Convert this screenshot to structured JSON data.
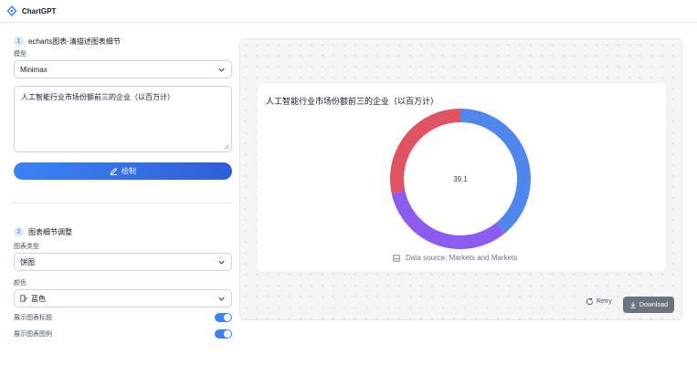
{
  "app": {
    "title": "ChartGPT",
    "logo_icon": "chartgpt-logo-icon"
  },
  "step1": {
    "number": "1",
    "title": "echarts图表-清描述图表细节"
  },
  "model": {
    "label": "模型",
    "value": "Minimax"
  },
  "prompt": {
    "value": "人工智能行业市场份额前三的企业（以百万计）"
  },
  "draw_button": {
    "label": "绘制",
    "icon": "edit-icon"
  },
  "step2": {
    "number": "2",
    "title": "图表细节调整"
  },
  "chart_type": {
    "label": "图表类型",
    "value": "饼图"
  },
  "color": {
    "label": "颜色",
    "value": "蓝色",
    "icon": "palette-icon"
  },
  "toggles": [
    {
      "label": "展示图表标题",
      "on": true
    },
    {
      "label": "展示图表图例",
      "on": true
    }
  ],
  "chart": {
    "title": "人工智能行业市场份额前三的企业（以百万计）",
    "center_label": "39.1",
    "source": "Data source: Markets and Markets"
  },
  "chart_data": {
    "type": "pie",
    "title": "人工智能行业市场份额前三的企业（以百万计）",
    "values": [
      39.1,
      32.5,
      28.4
    ],
    "colors": [
      "#5087ec",
      "#8c5bf0",
      "#e15263"
    ],
    "center_label": "39.1"
  },
  "actions": {
    "retry_label": "Retry",
    "download_label": "Download"
  },
  "colors": {
    "accent": "#3b82f6",
    "panel_bg": "#f5f5f6"
  }
}
